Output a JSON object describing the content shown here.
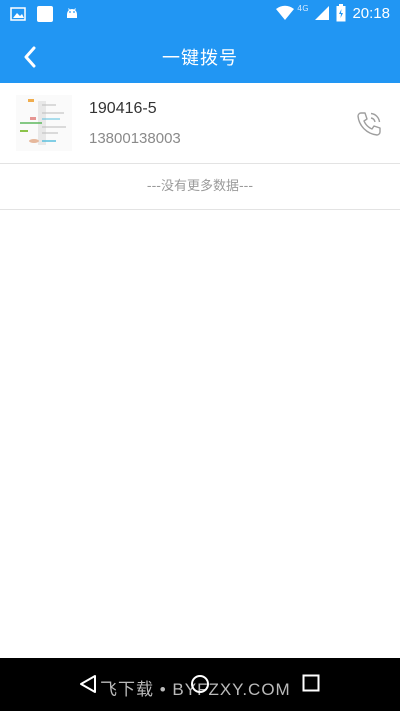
{
  "status_bar": {
    "time": "20:18",
    "network": "4G",
    "left_icons": [
      "gallery-icon",
      "app-square-icon",
      "android-icon"
    ],
    "right_icons": [
      "wifi-icon",
      "signal-icon",
      "battery-icon"
    ]
  },
  "header": {
    "title": "一键拨号",
    "back_icon": "chevron-left-icon",
    "bg_color": "#2196f3"
  },
  "contacts": [
    {
      "name": "190416-5",
      "phone": "13800138003",
      "avatar_icon": "mindmap-thumbnail",
      "action_icon": "phone-call-icon"
    }
  ],
  "list_footer": "---没有更多数据---",
  "nav_bar": {
    "watermark": "飞下载 • BYFZXY.COM",
    "icons": [
      "nav-back-icon",
      "nav-home-icon",
      "nav-recent-icon"
    ]
  }
}
